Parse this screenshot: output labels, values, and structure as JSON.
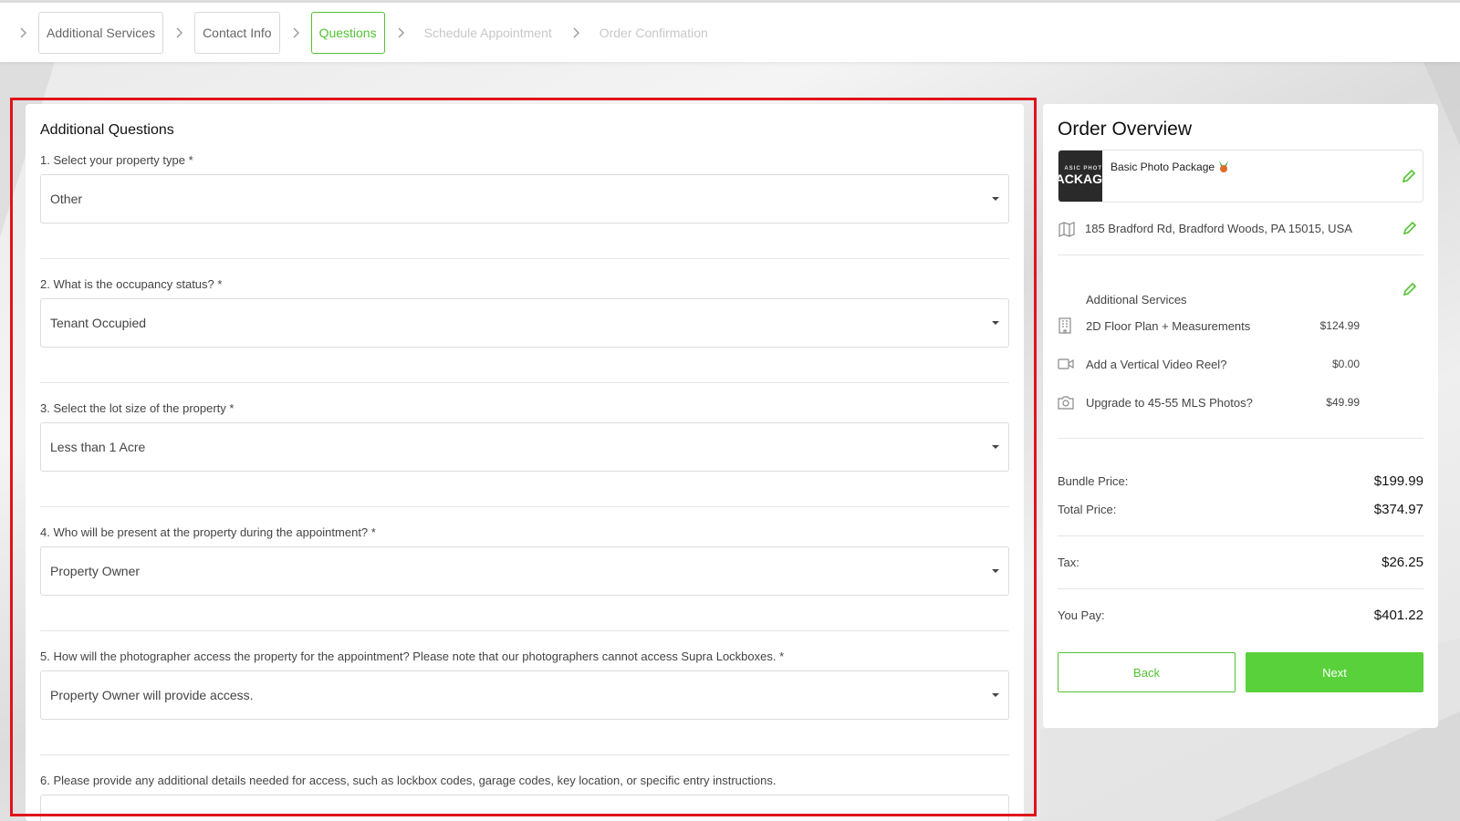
{
  "steps": [
    {
      "label": "Additional Services",
      "state": "done"
    },
    {
      "label": "Contact Info",
      "state": "done"
    },
    {
      "label": "Questions",
      "state": "active"
    },
    {
      "label": "Schedule Appointment",
      "state": "disabled"
    },
    {
      "label": "Order Confirmation",
      "state": "disabled"
    }
  ],
  "questions": {
    "title": "Additional Questions",
    "items": [
      {
        "label": "1. Select your property type *",
        "value": "Other"
      },
      {
        "label": "2. What is the occupancy status? *",
        "value": "Tenant Occupied"
      },
      {
        "label": "3. Select the lot size of the property *",
        "value": "Less than 1 Acre"
      },
      {
        "label": "4. Who will be present at the property during the appointment? *",
        "value": "Property Owner"
      },
      {
        "label": "5. How will the photographer access the property for the appointment? Please note that our photographers cannot access Supra Lockboxes. *",
        "value": "Property Owner will provide access."
      },
      {
        "label": "6. Please provide any additional details needed for access, such as lockbox codes, garage codes, key location, or specific entry instructions.",
        "value": ""
      }
    ]
  },
  "overview": {
    "title": "Order Overview",
    "package": {
      "name": "Basic Photo Package",
      "thumb_top": "ASIC PHOT",
      "thumb_main": "ACKAG"
    },
    "address": "185 Bradford Rd, Bradford Woods, PA 15015, USA",
    "services_title": "Additional Services",
    "services": [
      {
        "name": "2D Floor Plan + Measurements",
        "price": "$124.99",
        "icon": "floorplan-icon"
      },
      {
        "name": "Add a Vertical Video Reel?",
        "price": "$0.00",
        "icon": "video-icon"
      },
      {
        "name": "Upgrade to 45-55 MLS Photos?",
        "price": "$49.99",
        "icon": "camera-icon"
      }
    ],
    "bundle_label": "Bundle Price:",
    "bundle_value": "$199.99",
    "total_label": "Total Price:",
    "total_value": "$374.97",
    "tax_label": "Tax:",
    "tax_value": "$26.25",
    "pay_label": "You Pay:",
    "pay_value": "$401.22",
    "back_label": "Back",
    "next_label": "Next"
  },
  "colors": {
    "accent": "#52c232",
    "highlight": "#e0141b"
  }
}
